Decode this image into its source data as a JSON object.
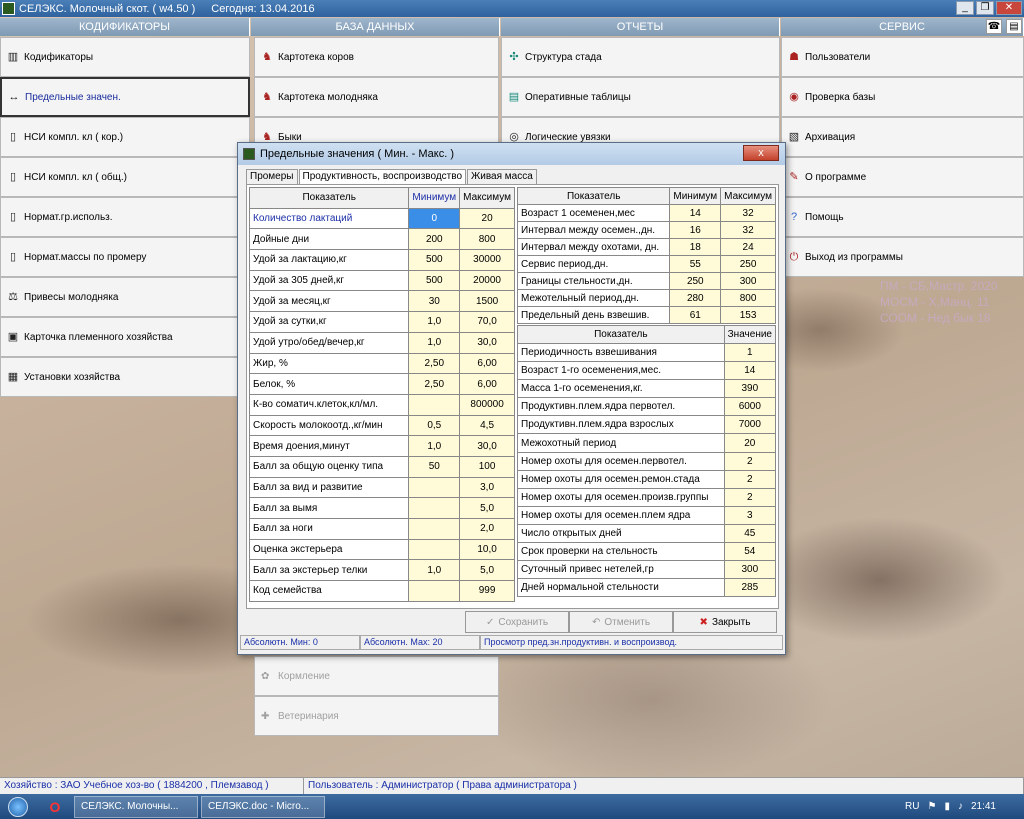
{
  "titlebar": {
    "app": "СЕЛЭКС. Молочный скот. ( w4.50 )",
    "date": "Сегодня: 13.04.2016"
  },
  "menus": {
    "headers": [
      "КОДИФИКАТОРЫ",
      "БАЗА ДАННЫХ",
      "ОТЧЕТЫ",
      "СЕРВИС"
    ],
    "col1": [
      "Кодификаторы",
      "Предельные значен.",
      "НСИ компл. кл ( кор.)",
      "НСИ компл. кл ( общ.)",
      "Нормат.гр.использ.",
      "Нормат.массы по промеру",
      "Привесы молодняка",
      "Карточка племенного хозяйства",
      "Установки хозяйства"
    ],
    "col2": [
      "Картотека коров",
      "Картотека молодняка",
      "Быки"
    ],
    "col2_lower": [
      "Кормление",
      "Ветеринария"
    ],
    "col3": [
      "Структура стада",
      "Оперативные таблицы",
      "Логические увязки"
    ],
    "col4": [
      "Пользователи",
      "Проверка базы",
      "Архивация",
      "О программе",
      "Помощь",
      "Выход из программы"
    ]
  },
  "watermark": [
    "ПМ - СБ,Мастр. 2020",
    "МОСМ - Х,Манц. 11",
    "СООМ - Нед бык 18"
  ],
  "dialog": {
    "title": "Предельные значения ( Мин. - Макс. )",
    "close": "x",
    "tabs": [
      "Промеры",
      "Продуктивность, воспроизводство",
      "Живая масса"
    ],
    "tableA": {
      "headers": [
        "Показатель",
        "Минимум",
        "Максимум"
      ],
      "rows": [
        [
          "Количество лактаций",
          "0",
          "20"
        ],
        [
          "Дойные дни",
          "200",
          "800"
        ],
        [
          "Удой за лактацию,кг",
          "500",
          "30000"
        ],
        [
          "Удой за 305 дней,кг",
          "500",
          "20000"
        ],
        [
          "Удой за месяц,кг",
          "30",
          "1500"
        ],
        [
          "Удой за сутки,кг",
          "1,0",
          "70,0"
        ],
        [
          "Удой утро/обед/вечер,кг",
          "1,0",
          "30,0"
        ],
        [
          "Жир, %",
          "2,50",
          "6,00"
        ],
        [
          "Белок, %",
          "2,50",
          "6,00"
        ],
        [
          "К-во соматич.клеток,кл/мл.",
          "",
          "800000"
        ],
        [
          "Скорость молокоотд.,кг/мин",
          "0,5",
          "4,5"
        ],
        [
          "Время доения,минут",
          "1,0",
          "30,0"
        ],
        [
          "Балл за общую оценку типа",
          "50",
          "100"
        ],
        [
          "Балл за вид и развитие",
          "",
          "3,0"
        ],
        [
          "Балл за вымя",
          "",
          "5,0"
        ],
        [
          "Балл за ноги",
          "",
          "2,0"
        ],
        [
          "Оценка экстерьера",
          "",
          "10,0"
        ],
        [
          "Балл за экстерьер телки",
          "1,0",
          "5,0"
        ],
        [
          "Код семейства",
          "",
          "999"
        ]
      ]
    },
    "tableB": {
      "headers": [
        "Показатель",
        "Минимум",
        "Максимум"
      ],
      "rows": [
        [
          "Возраст 1 осеменен,мес",
          "14",
          "32"
        ],
        [
          "Интервал между осемен.,дн.",
          "16",
          "32"
        ],
        [
          "Интервал между охотами, дн.",
          "18",
          "24"
        ],
        [
          "Сервис период,дн.",
          "55",
          "250"
        ],
        [
          "Границы стельности,дн.",
          "250",
          "300"
        ],
        [
          "Межотельный период,дн.",
          "280",
          "800"
        ],
        [
          "Предельный день взвешив.",
          "61",
          "153"
        ]
      ]
    },
    "tableC": {
      "headers": [
        "Показатель",
        "Значение"
      ],
      "rows": [
        [
          "Периодичность взвешивания",
          "1"
        ],
        [
          "Возраст 1-го осеменения,мес.",
          "14"
        ],
        [
          "Масса 1-го осеменения,кг.",
          "390"
        ],
        [
          "Продуктивн.плем.ядра первотел.",
          "6000"
        ],
        [
          "Продуктивн.плем.ядра взрослых",
          "7000"
        ],
        [
          "Межохотный период",
          "20"
        ],
        [
          "Номер охоты для осемен.первотел.",
          "2"
        ],
        [
          "Номер охоты для осемен.ремон.стада",
          "2"
        ],
        [
          "Номер охоты для осемен.произв.группы",
          "2"
        ],
        [
          "Номер охоты для осемен.плем ядра",
          "3"
        ],
        [
          "Число открытых дней",
          "45"
        ],
        [
          "Срок проверки на стельность",
          "54"
        ],
        [
          "Суточный привес нетелей,гр",
          "300"
        ],
        [
          "Дней нормальной стельности",
          "285"
        ]
      ]
    },
    "buttons": {
      "save": "Сохранить",
      "cancel": "Отменить",
      "close": "Закрыть"
    },
    "status": [
      "Абсолютн. Мин: 0",
      "Абсолютн. Мах: 20",
      "Просмотр пред.зн.продуктивн. и воспроизвод."
    ]
  },
  "appstatus": {
    "farm": "Хозяйство : ЗАО Учебное хоз-во ( 1884200 , Племзавод )",
    "user": "Пользователь : Администратор ( Права администратора )"
  },
  "taskbar": {
    "tasks": [
      "СЕЛЭКС. Молочны...",
      "СЕЛЭКС.doc - Micro..."
    ],
    "lang": "RU",
    "time": "21:41"
  }
}
